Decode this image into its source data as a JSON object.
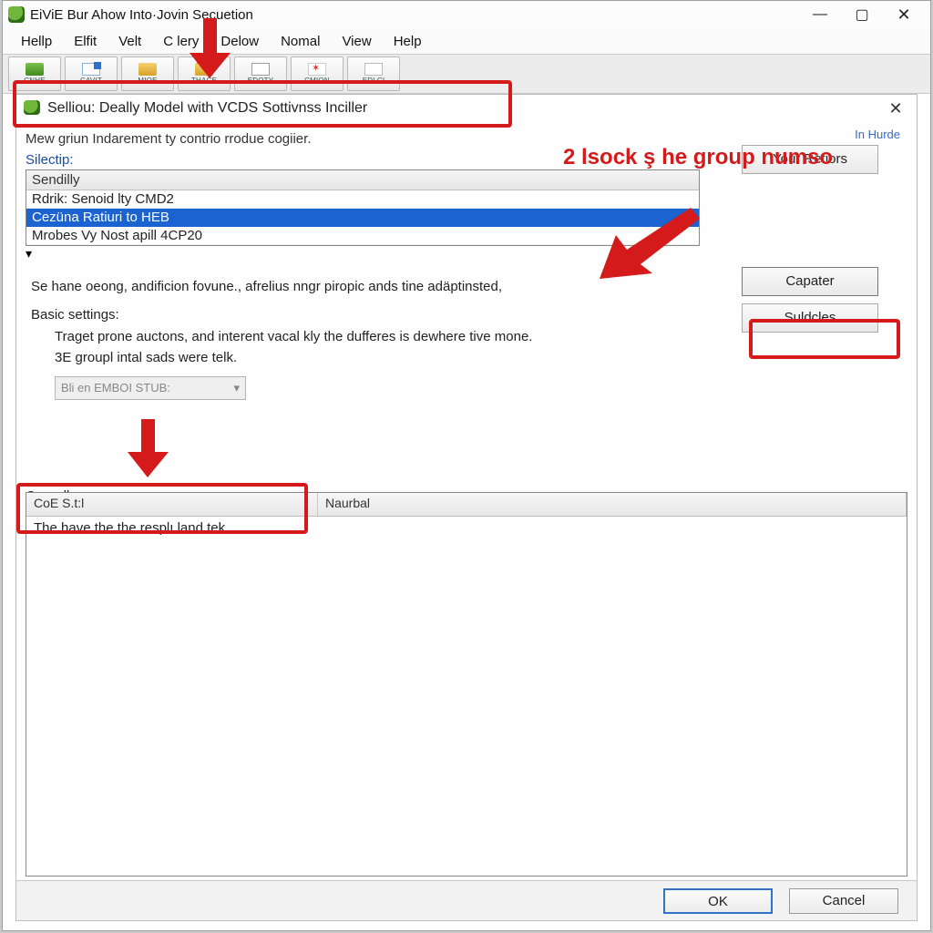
{
  "window": {
    "title": "EiViE Bur Ahow Into·Jovin Secuetion"
  },
  "menubar": [
    "Hellp",
    "Elfit",
    "Velt",
    "C   lery",
    "Delow",
    "Nomal",
    "View",
    "Help"
  ],
  "toolbar": [
    {
      "icon": "a",
      "label": "CNHE"
    },
    {
      "icon": "b",
      "label": "CAVIT"
    },
    {
      "icon": "c",
      "label": "MIOE"
    },
    {
      "icon": "d",
      "label": "THACE"
    },
    {
      "icon": "e",
      "label": "EDOTY"
    },
    {
      "icon": "f",
      "label": "CMION"
    },
    {
      "icon": "g",
      "label": "EDLCI"
    }
  ],
  "dialog": {
    "title": "Selliou: Deally Model with VCDS Sottivnss Inciller",
    "instruction": "Mew griun Indarement ty contrio rrodue cogiier.",
    "field_label": "Silectip:",
    "list_header": "Sendilly",
    "list_items": [
      "Rdrik: Senoid lty CMD2",
      "Cezüna Ratiuri to HEB",
      "Mrobes Vy Nost apill 4CP20"
    ],
    "selected_index": 1,
    "hint": "Se hane oeong, andificion fovune., afrelius nngr piropic ands tine adäptinsted,",
    "basic_settings_label": "Basic settings:",
    "basic_line1": "Traget prone auctons, and interent vacal kly the dufferes is dewhere tive mone.",
    "basic_line2": "3E groupl intal sads were telk.",
    "combo_placeholder": "Bli en EMBOI STUB:",
    "side_small": "In Hurde",
    "side_buttons": {
      "top": "Your Retiors",
      "primary": "Capater",
      "secondary": "Suldcles"
    },
    "grid_label": "Orenally",
    "grid_headers": [
      "CoE S.t:l",
      "Naurbal"
    ],
    "grid_row1": "The have the the resplı land tek."
  },
  "footer": {
    "ok": "OK",
    "cancel": "Cancel"
  },
  "annotations": {
    "callout": "2 lsock ş he group numso"
  }
}
